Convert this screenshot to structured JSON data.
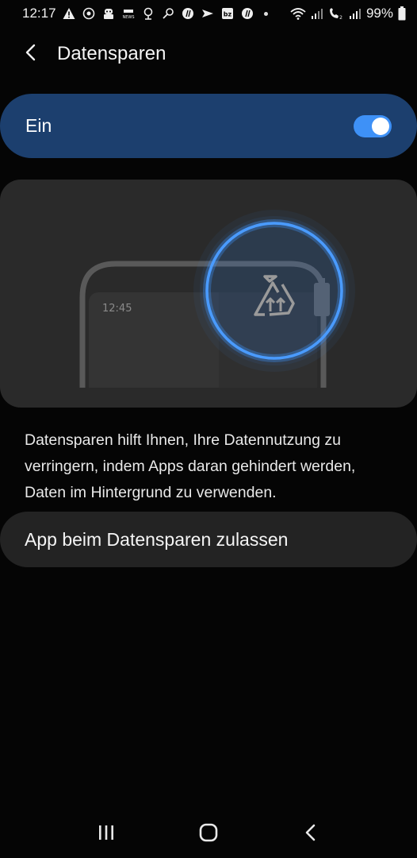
{
  "status_bar": {
    "time": "12:17",
    "battery_text": "99%",
    "icons": [
      "warning-icon",
      "target-icon",
      "robot-icon",
      "news-icon",
      "location-icon",
      "key-icon",
      "browser-icon",
      "vpn-icon",
      "bz-icon",
      "browser-icon",
      "wifi-icon",
      "signal-icon",
      "call-icon",
      "signal-icon",
      "battery-icon"
    ]
  },
  "header": {
    "title": "Datensparen",
    "back_icon": "chevron-left-icon"
  },
  "master_switch": {
    "label": "Ein",
    "state": "on"
  },
  "illustration": {
    "clock_text": "12:45",
    "icon": "data-saver-icon"
  },
  "description": "Datensparen hilft Ihnen, Ihre Datennutzung zu verringern, indem Apps daran gehindert werden, Daten im Hintergrund zu verwenden.",
  "list": {
    "unrestricted_apps_label": "App beim Datensparen zulassen"
  },
  "nav_bar": {
    "recents_icon": "recents-icon",
    "home_icon": "home-icon",
    "back_icon": "back-icon"
  },
  "colors": {
    "accent": "#3e91f7",
    "switch_bg": "#1c3f6e",
    "card_bg": "#2a2a2a",
    "list_bg": "#232323",
    "background": "#050505"
  }
}
